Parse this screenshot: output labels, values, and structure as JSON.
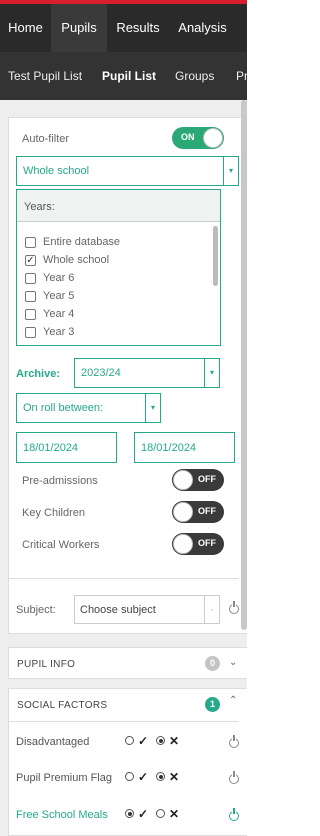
{
  "top_nav": {
    "items": [
      "Home",
      "Pupils",
      "Results",
      "Analysis"
    ],
    "active": "Pupils"
  },
  "sub_nav": {
    "items": [
      "Test Pupil List",
      "Pupil List",
      "Groups",
      "Pr"
    ],
    "active": "Pupil List"
  },
  "filters": {
    "auto_filter_label": "Auto-filter",
    "auto_filter_state": "ON",
    "scope_select": "Whole school",
    "years_header": "Years:",
    "years": [
      {
        "label": "Entire database",
        "checked": false
      },
      {
        "label": "Whole school",
        "checked": true
      },
      {
        "label": "Year 6",
        "checked": false
      },
      {
        "label": "Year 5",
        "checked": false
      },
      {
        "label": "Year 4",
        "checked": false
      },
      {
        "label": "Year 3",
        "checked": false
      }
    ],
    "archive_label": "Archive:",
    "archive_value": "2023/24",
    "on_roll_select": "On roll between:",
    "date_from": "18/01/2024",
    "date_to": "18/01/2024",
    "toggles": [
      {
        "label": "Pre-admissions",
        "state": "OFF"
      },
      {
        "label": "Key Children",
        "state": "OFF"
      },
      {
        "label": "Critical Workers",
        "state": "OFF"
      }
    ],
    "subject_label": "Subject:",
    "subject_placeholder": "Choose subject"
  },
  "sections": {
    "pupil_info": {
      "title": "PUPIL INFO",
      "count": "0"
    },
    "social_factors": {
      "title": "SOCIAL FACTORS",
      "count": "1"
    }
  },
  "factors": [
    {
      "label": "Disadvantaged",
      "selected": "check"
    },
    {
      "label": "Pupil Premium Flag",
      "selected": "check"
    },
    {
      "label": "Free School Meals",
      "selected": "dot",
      "active": true
    }
  ],
  "colors": {
    "accent": "#26a98a",
    "topbar": "#2a2a2a",
    "brand_red": "#d71f2b",
    "toggle_on": "#2aa876",
    "toggle_off": "#3a3a3a"
  }
}
